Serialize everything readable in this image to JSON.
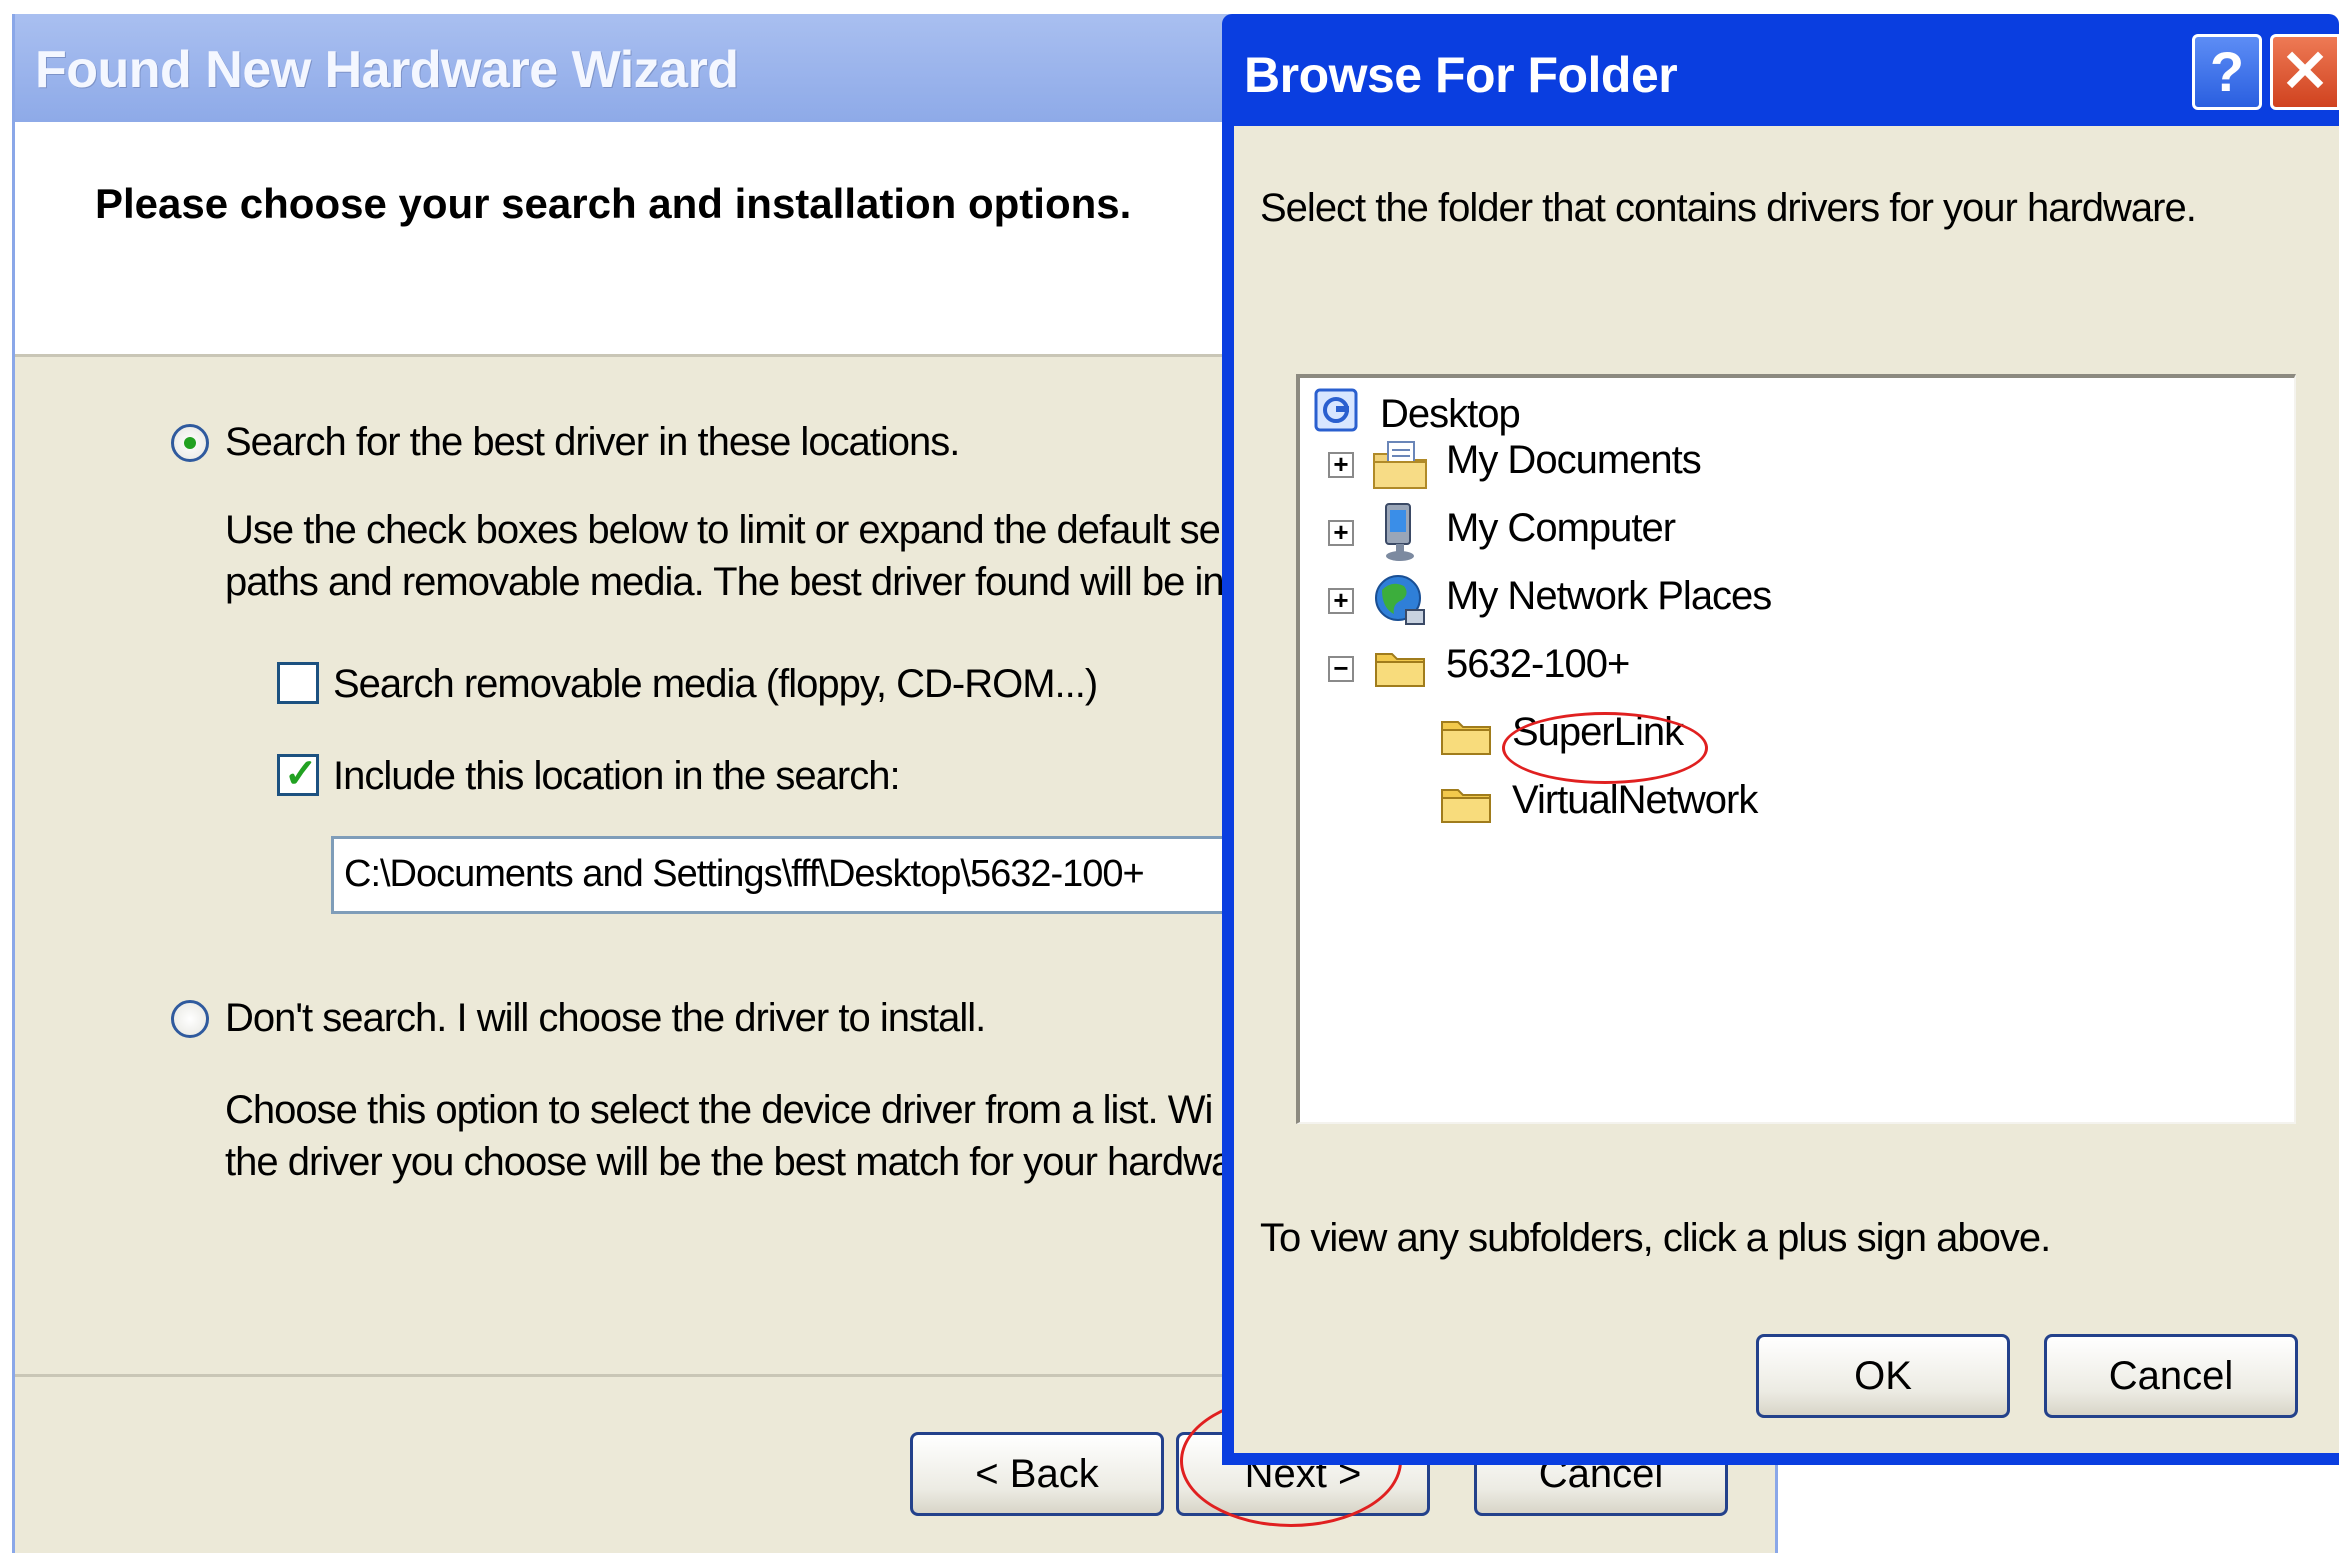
{
  "wizard": {
    "title": "Found New Hardware Wizard",
    "heading": "Please choose your search and installation options.",
    "option_search": {
      "label": "Search for the best driver in these locations.",
      "selected": true,
      "description_line1": "Use the check boxes below to limit or expand the default se",
      "description_line2": "paths and removable media. The best driver found will be ins"
    },
    "checkbox_removable": {
      "label": "Search removable media (floppy, CD-ROM...)",
      "checked": false
    },
    "checkbox_include": {
      "label": "Include this location in the search:",
      "checked": true
    },
    "path_value": "C:\\Documents and Settings\\fff\\Desktop\\5632-100+",
    "option_dont_search": {
      "label": "Don't search. I will choose the driver to install.",
      "selected": false,
      "description_line1": "Choose this option to select the device driver from a list.  Wi",
      "description_line2": "the driver you choose will be the best match for your hardwa"
    },
    "buttons": {
      "back": "< Back",
      "next": "Next >",
      "cancel": "Cancel"
    }
  },
  "browse_dialog": {
    "title": "Browse For Folder",
    "help_glyph": "?",
    "close_glyph": "✕",
    "instruction": "Select the folder that contains drivers for your hardware.",
    "tree": {
      "root": "Desktop",
      "items": [
        {
          "label": "My Documents",
          "expander": "+",
          "icon": "my-documents-icon"
        },
        {
          "label": "My Computer",
          "expander": "+",
          "icon": "my-computer-icon"
        },
        {
          "label": "My Network Places",
          "expander": "+",
          "icon": "network-places-icon"
        },
        {
          "label": "5632-100+",
          "expander": "−",
          "icon": "folder-icon"
        }
      ],
      "children": [
        {
          "label": "SuperLink",
          "icon": "folder-icon",
          "highlighted": true
        },
        {
          "label": "VirtualNetwork",
          "icon": "folder-icon"
        }
      ]
    },
    "hint": "To view any subfolders, click a plus sign above.",
    "buttons": {
      "ok": "OK",
      "cancel": "Cancel"
    }
  },
  "colors": {
    "dialog_frame": "#0a3ee0",
    "window_face": "#ece9d8",
    "annotation_circle": "#e02020",
    "check_green": "#21a121"
  }
}
